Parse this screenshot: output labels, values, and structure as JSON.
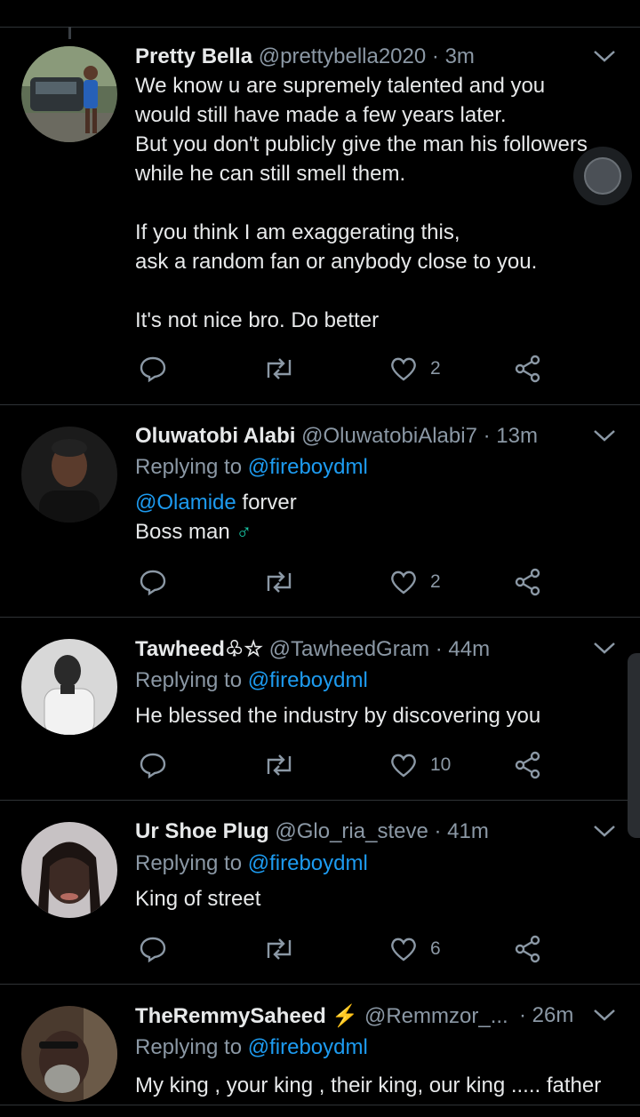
{
  "tweets": [
    {
      "name": "Pretty Bella",
      "handle": "@prettybella2020",
      "time": "3m",
      "body_lines": [
        "We know u are supremely talented and you",
        "would still have made a few years later.",
        "But you don't publicly give the man his followers",
        "while he can still smell them.",
        "",
        "If you think I am exaggerating this,",
        "ask a random fan or anybody close to you.",
        "",
        "It's not nice bro. Do better"
      ],
      "likes": "2"
    },
    {
      "name": "Oluwatobi Alabi",
      "handle": "@OluwatobiAlabi7",
      "time": "13m",
      "replying_prefix": "Replying to",
      "replying_to": "@fireboydml",
      "body_mention": "@Olamide",
      "body_line1_rest": " forver",
      "body_line2": "Boss man",
      "body_emoji": "♂",
      "likes": "2"
    },
    {
      "name": "Tawheed♧☆",
      "handle": "@TawheedGram",
      "time": "44m",
      "replying_prefix": "Replying to",
      "replying_to": "@fireboydml",
      "body": "He blessed the industry by discovering you",
      "likes": "10"
    },
    {
      "name": "Ur Shoe Plug",
      "handle": "@Glo_ria_steve",
      "time": "41m",
      "replying_prefix": "Replying to",
      "replying_to": "@fireboydml",
      "body": "King of street",
      "likes": "6"
    },
    {
      "name": "TheRemmySaheed",
      "name_emoji": "⚡",
      "handle": "@Remmzor_...",
      "time": "26m",
      "replying_prefix": "Replying to",
      "replying_to": "@fireboydml",
      "body": "My king , your king , their king, our king ..... father"
    }
  ],
  "separator": "·",
  "colors": {
    "background": "#000000",
    "text": "#e7e9ea",
    "muted": "#8b98a5",
    "link": "#1d9bf0",
    "divider": "#2f3336",
    "male_sign": "#19c7a6"
  },
  "icons": [
    "reply-icon",
    "retweet-icon",
    "like-icon",
    "share-icon",
    "chevron-down-icon"
  ]
}
